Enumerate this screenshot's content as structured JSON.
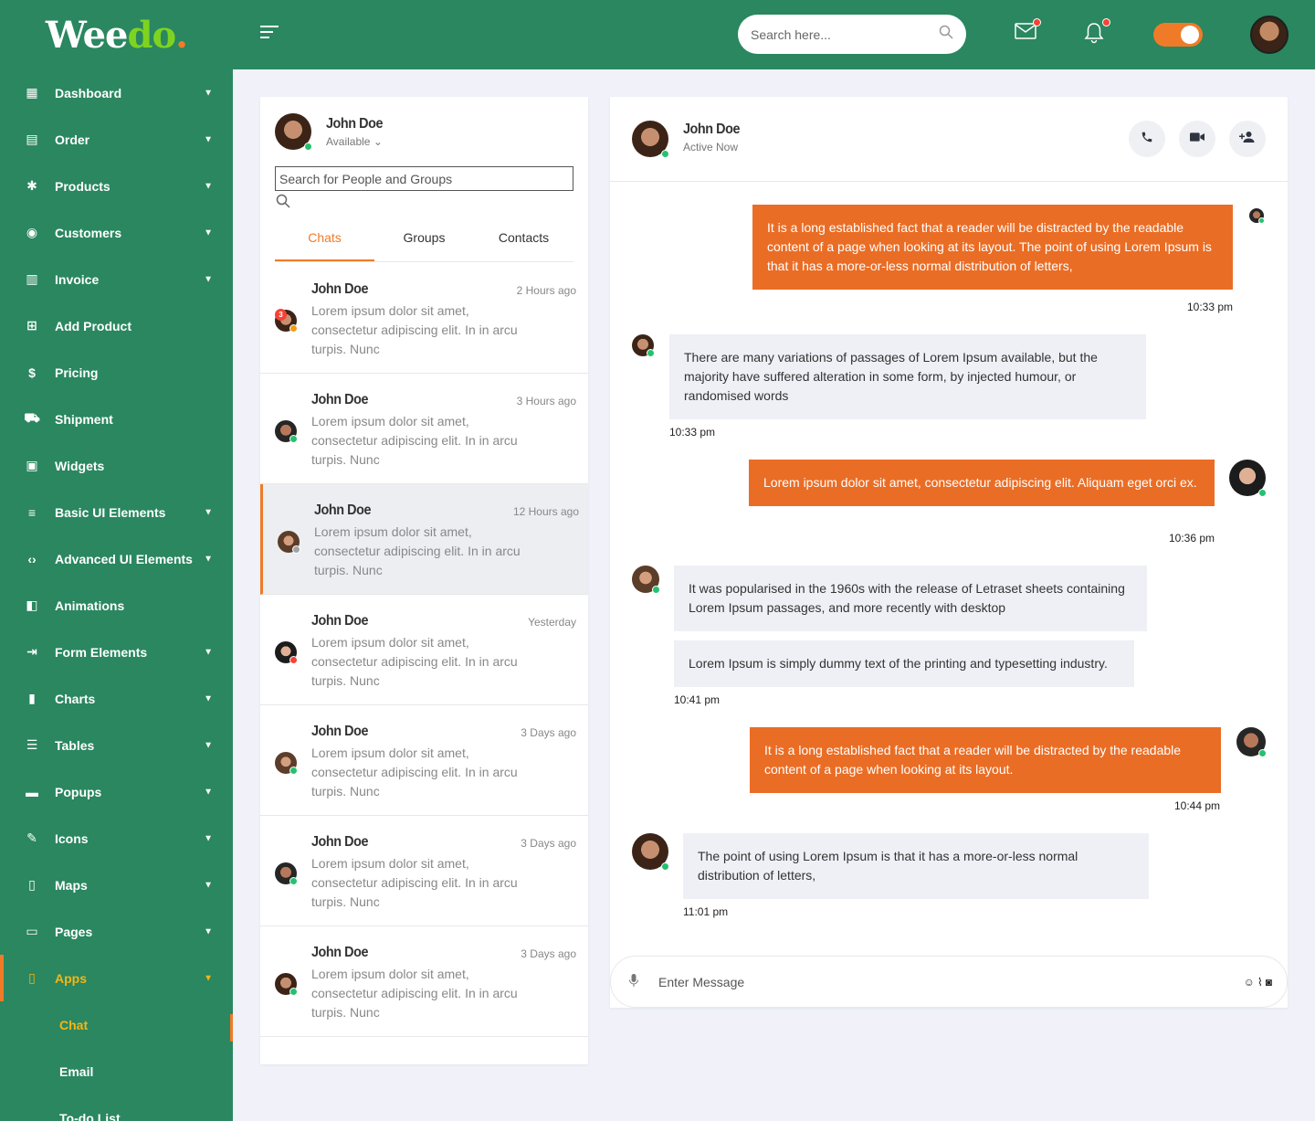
{
  "brand": {
    "part1": "Wee",
    "part2": "do",
    "dot": "."
  },
  "sidebar": {
    "items": [
      {
        "label": "Dashboard",
        "icon": "dashboard-icon",
        "glyph": "▦",
        "caret": true
      },
      {
        "label": "Order",
        "icon": "clipboard-icon",
        "glyph": "▤",
        "caret": true
      },
      {
        "label": "Products",
        "icon": "leaf-icon",
        "glyph": "✱",
        "caret": true
      },
      {
        "label": "Customers",
        "icon": "users-icon",
        "glyph": "◉",
        "caret": true
      },
      {
        "label": "Invoice",
        "icon": "invoice-icon",
        "glyph": "▥",
        "caret": true
      },
      {
        "label": "Add Product",
        "icon": "plus-square-icon",
        "glyph": "⊞",
        "caret": false
      },
      {
        "label": "Pricing",
        "icon": "dollar-icon",
        "glyph": "$",
        "caret": false
      },
      {
        "label": "Shipment",
        "icon": "truck-icon",
        "glyph": "⛟",
        "caret": false
      },
      {
        "label": "Widgets",
        "icon": "widgets-icon",
        "glyph": "▣",
        "caret": false
      },
      {
        "label": "Basic UI Elements",
        "icon": "filter-icon",
        "glyph": "≡",
        "caret": true
      },
      {
        "label": "Advanced UI Elements",
        "icon": "code-icon",
        "glyph": "‹›",
        "caret": true
      },
      {
        "label": "Animations",
        "icon": "paint-roller-icon",
        "glyph": "◧",
        "caret": false
      },
      {
        "label": "Form Elements",
        "icon": "form-icon",
        "glyph": "⇥",
        "caret": true
      },
      {
        "label": "Charts",
        "icon": "bar-chart-icon",
        "glyph": "▮",
        "caret": true
      },
      {
        "label": "Tables",
        "icon": "sliders-icon",
        "glyph": "☰",
        "caret": true
      },
      {
        "label": "Popups",
        "icon": "message-icon",
        "glyph": "▬",
        "caret": true
      },
      {
        "label": "Icons",
        "icon": "pen-icon",
        "glyph": "✎",
        "caret": true
      },
      {
        "label": "Maps",
        "icon": "map-icon",
        "glyph": "▯",
        "caret": true
      },
      {
        "label": "Pages",
        "icon": "file-icon",
        "glyph": "▭",
        "caret": true
      },
      {
        "label": "Apps",
        "icon": "mobile-icon",
        "glyph": "▯",
        "caret": true,
        "active": true
      }
    ],
    "sub_items": [
      {
        "label": "Chat",
        "active": true
      },
      {
        "label": "Email",
        "active": false
      },
      {
        "label": "To-do List",
        "active": false
      }
    ]
  },
  "topbar": {
    "search_placeholder": "Search here...",
    "mail_icon": "mail-icon",
    "bell_icon": "bell-icon"
  },
  "me": {
    "name": "John Doe",
    "status": "Available"
  },
  "list": {
    "search_placeholder": "Search for People and Groups",
    "tabs": [
      "Chats",
      "Groups",
      "Contacts"
    ],
    "active_tab": 0,
    "conversations": [
      {
        "name": "John Doe",
        "time": "2 Hours ago",
        "preview": "Lorem ipsum dolor sit amet, consectetur adipiscing elit. In in arcu turpis. Nunc",
        "avatar": "male1",
        "status": "orange",
        "count": "3"
      },
      {
        "name": "John Doe",
        "time": "3 Hours ago",
        "preview": "Lorem ipsum dolor sit amet, consectetur adipiscing elit. In in arcu turpis. Nunc",
        "avatar": "male2",
        "status": "green"
      },
      {
        "name": "John Doe",
        "time": "12 Hours ago",
        "preview": "Lorem ipsum dolor sit amet, consectetur adipiscing elit. In in arcu turpis. Nunc",
        "avatar": "male3",
        "status": "grey",
        "selected": true
      },
      {
        "name": "John Doe",
        "time": "Yesterday",
        "preview": "Lorem ipsum dolor sit amet, consectetur adipiscing elit. In in arcu turpis. Nunc",
        "avatar": "fem1",
        "status": "red"
      },
      {
        "name": "John Doe",
        "time": "3 Days ago",
        "preview": "Lorem ipsum dolor sit amet, consectetur adipiscing elit. In in arcu turpis. Nunc",
        "avatar": "male3",
        "status": "green"
      },
      {
        "name": "John Doe",
        "time": "3 Days ago",
        "preview": "Lorem ipsum dolor sit amet, consectetur adipiscing elit. In in arcu turpis. Nunc",
        "avatar": "male2",
        "status": "green"
      },
      {
        "name": "John Doe",
        "time": "3 Days ago",
        "preview": "Lorem ipsum dolor sit amet, consectetur adipiscing elit. In in arcu turpis. Nunc",
        "avatar": "male1",
        "status": "green"
      }
    ]
  },
  "chat": {
    "name": "John Doe",
    "status": "Active Now",
    "actions": [
      "phone-icon",
      "video-icon",
      "add-user-icon"
    ],
    "messages": [
      {
        "dir": "out",
        "text": "It is a long established fact that a reader will be distracted by the readable content of a page when looking at its layout. The point of using Lorem Ipsum is that it has a more-or-less normal distribution of letters,",
        "time": "10:33 pm"
      },
      {
        "dir": "in",
        "text": "There are many variations of passages of Lorem Ipsum available, but the majority have suffered alteration in some form, by injected humour, or randomised words",
        "time": "10:33 pm"
      },
      {
        "dir": "out",
        "text": "Lorem ipsum dolor sit amet, consectetur adipiscing elit. Aliquam eget orci ex.",
        "time": "10:36 pm"
      },
      {
        "dir": "in",
        "text": "It was popularised in the 1960s with the release of Letraset sheets containing Lorem Ipsum passages, and more recently with desktop",
        "time": ""
      },
      {
        "dir": "in",
        "text": "Lorem Ipsum is simply dummy text of the printing and typesetting industry.",
        "time": "10:41 pm"
      },
      {
        "dir": "out",
        "text": "It is a long established fact that a reader will be distracted by the readable content of a page when looking at its layout.",
        "time": "10:44 pm"
      },
      {
        "dir": "in",
        "text": "The point of using Lorem Ipsum is that it has a more-or-less normal distribution of letters,",
        "time": "11:01 pm"
      }
    ],
    "composer_placeholder": "Enter Message"
  },
  "colors": {
    "brand_green": "#2a8760",
    "accent_orange": "#ea6d25",
    "active_yellow": "#f5b515",
    "bubble_in": "#eff0f6"
  }
}
